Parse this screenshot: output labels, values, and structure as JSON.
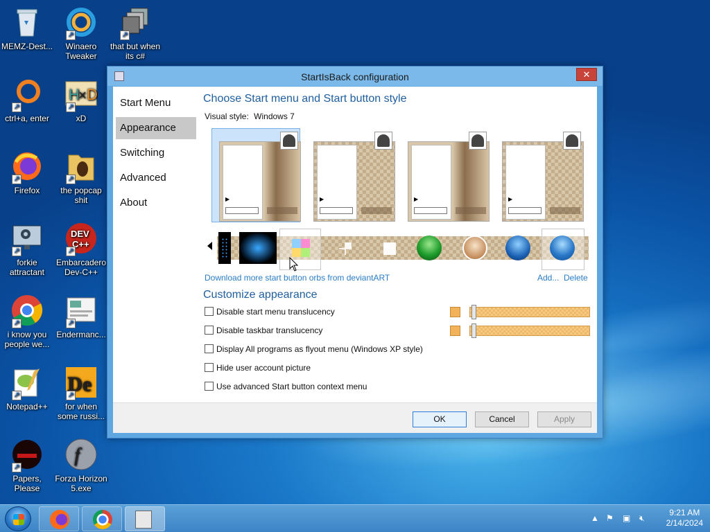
{
  "desktop": {
    "icons": [
      {
        "label": "MEMZ-Dest..."
      },
      {
        "label": "Winaero Tweaker"
      },
      {
        "label": "that but when its c#"
      },
      {
        "label": "ctrl+a, enter"
      },
      {
        "label": "xD"
      },
      {
        "label": "Firefox"
      },
      {
        "label": "the popcap shit"
      },
      {
        "label": "forkie attractant"
      },
      {
        "label": "Embarcadero Dev-C++"
      },
      {
        "label": "i know you people we..."
      },
      {
        "label": "Endermanc..."
      },
      {
        "label": "Notepad++"
      },
      {
        "label": "for when some russi..."
      },
      {
        "label": "Papers, Please"
      },
      {
        "label": "Forza Horizon 5.exe"
      }
    ]
  },
  "window": {
    "title": "StartIsBack configuration",
    "close_label": "✕",
    "nav": [
      {
        "label": "Start Menu",
        "active": false
      },
      {
        "label": "Appearance",
        "active": true
      },
      {
        "label": "Switching",
        "active": false
      },
      {
        "label": "Advanced",
        "active": false
      },
      {
        "label": "About",
        "active": false
      }
    ],
    "section1_title": "Choose Start menu and Start button style",
    "visual_style_label": "Visual style:",
    "visual_style_value": "Windows 7",
    "download_link": "Download more start button orbs from deviantART",
    "add_link": "Add...",
    "delete_link": "Delete",
    "section2_title": "Customize appearance",
    "checkboxes": [
      {
        "label": "Disable start menu translucency",
        "checked": false
      },
      {
        "label": "Disable taskbar translucency",
        "checked": false
      },
      {
        "label": "Display All programs as flyout menu (Windows XP style)",
        "checked": false
      },
      {
        "label": "Hide user account picture",
        "checked": false
      },
      {
        "label": "Use advanced Start button context menu",
        "checked": false
      }
    ],
    "swatch_color": "#f2b25a",
    "buttons": {
      "ok": "OK",
      "cancel": "Cancel",
      "apply": "Apply"
    }
  },
  "taskbar": {
    "time": "9:21 AM",
    "date": "2/14/2024"
  }
}
